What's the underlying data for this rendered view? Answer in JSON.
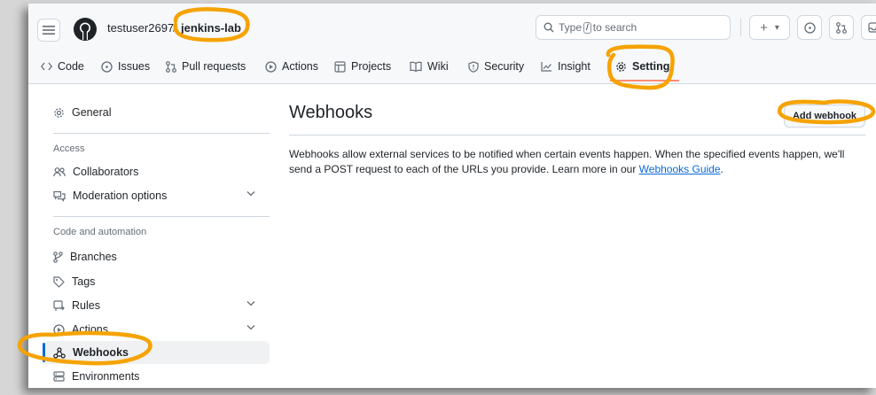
{
  "header": {
    "owner": "testuser2697",
    "separator": "/",
    "repo": "jenkins-lab",
    "search": {
      "prefix": "Type",
      "key": "/",
      "suffix": "to search"
    },
    "plus_label": "+",
    "caret": "▾"
  },
  "tabs": [
    {
      "label": "Code",
      "icon": "code-icon"
    },
    {
      "label": "Issues",
      "icon": "issue-icon"
    },
    {
      "label": "Pull requests",
      "icon": "pull-request-icon"
    },
    {
      "label": "Actions",
      "icon": "play-icon"
    },
    {
      "label": "Projects",
      "icon": "table-icon"
    },
    {
      "label": "Wiki",
      "icon": "book-icon"
    },
    {
      "label": "Security",
      "icon": "shield-icon"
    },
    {
      "label": "Insight",
      "icon": "graph-icon"
    },
    {
      "label": "Setting",
      "icon": "gear-icon",
      "active": true
    }
  ],
  "sidebar": {
    "general": "General",
    "access_heading": "Access",
    "collaborators": "Collaborators",
    "moderation": "Moderation options",
    "code_heading": "Code and automation",
    "branches": "Branches",
    "tags": "Tags",
    "rules": "Rules",
    "actions": "Actions",
    "webhooks": "Webhooks",
    "environments": "Environments"
  },
  "main": {
    "title": "Webhooks",
    "add_button": "Add webhook",
    "description": "Webhooks allow external services to be notified when certain events happen. When the specified events happen, we'll send a POST request to each of the URLs you provide. Learn more in our ",
    "guide_link": "Webhooks Guide",
    "period": "."
  },
  "colors": {
    "accent": "#0969da",
    "annotation": "#f5a300",
    "tab_underline": "#fd8c73"
  }
}
